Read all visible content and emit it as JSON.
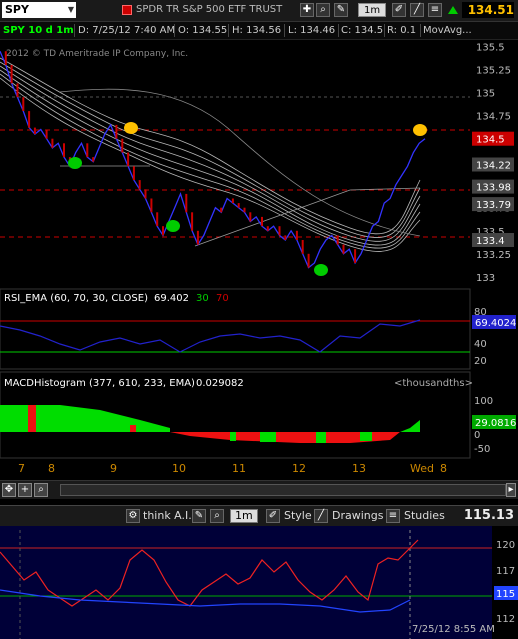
{
  "toolbar": {
    "symbol": "SPY",
    "description": "SPDR TR S&P 500 ETF TRUST",
    "timeframe": "1m",
    "last_price": "134.51"
  },
  "quote_bar": {
    "symbol": "SPY 10 d 1m",
    "date": "D: 7/25/12 7:40 AM",
    "open": "O: 134.55",
    "high": "H: 134.56",
    "low": "L: 134.46",
    "close": "C: 134.5",
    "range": "R: 0.1",
    "study": "MovAvg..."
  },
  "watermark": "2012 © TD Ameritrade IP Company, Inc.",
  "price_axis": {
    "ticks": [
      "135.5",
      "135.25",
      "135",
      "134.75",
      "134.5",
      "134.25",
      "134",
      "133.75",
      "133.5",
      "133.25",
      "133"
    ],
    "highlights": [
      {
        "label": "134.5",
        "bg": "#cc0000",
        "fg": "#ffffff"
      },
      {
        "label": "134.22",
        "bg": "#444444",
        "fg": "#ffffff"
      },
      {
        "label": "133.98",
        "bg": "#444444",
        "fg": "#ffffff"
      },
      {
        "label": "133.79",
        "bg": "#444444",
        "fg": "#ffffff"
      },
      {
        "label": "133.4",
        "bg": "#444444",
        "fg": "#ffffff"
      }
    ]
  },
  "rsi_panel": {
    "label": "RSI_EMA (60, 70, 30, CLOSE)",
    "value": "69.402",
    "oversold": "30",
    "overbought": "70",
    "axis_ticks": [
      "80",
      "40",
      "20"
    ],
    "current": "69.4024"
  },
  "macd_panel": {
    "label": "MACDHistogram (377, 610, 233, EMA)",
    "value": "0.029082",
    "units": "<thousandths>",
    "axis_ticks": [
      "100",
      "50",
      "0",
      "-50"
    ],
    "current": "29.0816"
  },
  "time_axis": {
    "labels": [
      "7",
      "8",
      "9",
      "10",
      "11",
      "12",
      "13",
      "Wed",
      "8"
    ]
  },
  "lower_toolbar": {
    "think_ai": "think A.I.",
    "timeframe": "1m",
    "style": "Style",
    "drawings": "Drawings",
    "studies": "Studies",
    "price": "115.13"
  },
  "lower_panel": {
    "axis_ticks": [
      "120",
      "117",
      "115",
      "112"
    ],
    "current": "115",
    "timestamp": "7/25/12 8:55 AM"
  },
  "colors": {
    "price_line": "#3333ff",
    "candle_down": "#cc0000",
    "ma_band": "#c0c0c0",
    "rsi_line": "#2222cc",
    "macd_pos": "#00dd00",
    "macd_neg": "#ee1111",
    "highlight_yellow": "#ffc000",
    "highlight_green": "#00cc00"
  },
  "chart_data": {
    "type": "line",
    "title": "SPY 10 d 1m",
    "ylim": [
      132.9,
      135.55
    ],
    "series": [
      {
        "name": "SPY",
        "values": [
          135.45,
          135.3,
          135.1,
          134.95,
          134.8,
          134.62,
          134.55,
          134.6,
          134.5,
          134.4,
          134.45,
          134.3,
          134.2,
          134.35,
          134.45,
          134.3,
          134.25,
          134.4,
          134.55,
          134.65,
          134.5,
          134.35,
          134.2,
          134.05,
          133.95,
          133.85,
          133.7,
          133.55,
          133.45,
          133.6,
          133.75,
          133.9,
          133.7,
          133.5,
          133.35,
          133.45,
          133.6,
          133.75,
          133.7,
          133.85,
          133.8,
          133.75,
          133.7,
          133.6,
          133.65,
          133.55,
          133.5,
          133.55,
          133.45,
          133.4,
          133.5,
          133.4,
          133.25,
          133.1,
          133.15,
          133.3,
          133.4,
          133.45,
          133.35,
          133.25,
          133.3,
          133.15,
          133.25,
          133.4,
          133.55,
          133.6,
          133.8,
          133.85,
          134.0,
          134.1,
          134.2,
          134.35,
          134.45,
          134.5
        ]
      }
    ]
  }
}
